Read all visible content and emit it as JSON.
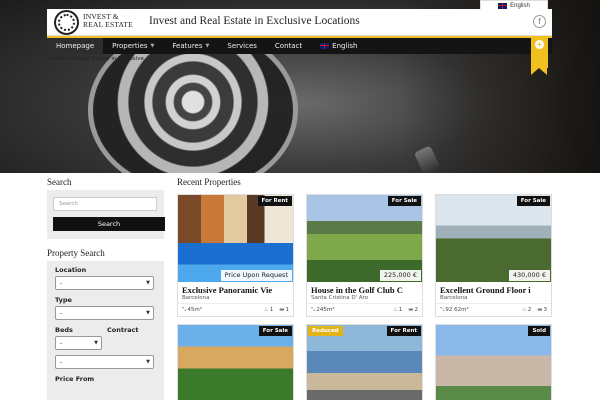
{
  "lang_top": "English",
  "header": {
    "logo_line1": "INVEST &",
    "logo_line2": "REAL ESTATE",
    "site_title": "Invest and Real Estate in Exclusive Locations"
  },
  "nav": {
    "items": [
      {
        "label": "Homepage",
        "dropdown": false
      },
      {
        "label": "Properties",
        "dropdown": true
      },
      {
        "label": "Features",
        "dropdown": true
      },
      {
        "label": "Services",
        "dropdown": false
      },
      {
        "label": "Contact",
        "dropdown": false
      },
      {
        "label": "English",
        "dropdown": false
      }
    ]
  },
  "breadcrumb": "Invest and Real Estate in Exclusive",
  "sidebar": {
    "search_title": "Search",
    "search_placeholder": "Search",
    "search_button": "Search",
    "property_search_title": "Property Search",
    "location_label": "Location",
    "location_value": "-",
    "type_label": "Type",
    "type_value": "-",
    "beds_label": "Beds",
    "beds_value": "-",
    "contract_label": "Contract",
    "contract_value": "-",
    "price_from_label": "Price From"
  },
  "main": {
    "title": "Recent Properties",
    "cards": [
      {
        "badge": "For Rent",
        "badge2": "",
        "price": "Price Upon Request",
        "title": "Exclusive Panoramic Vie",
        "location": "Barcelona",
        "area": "45m²",
        "baths": "1",
        "beds": "1"
      },
      {
        "badge": "For Sale",
        "badge2": "",
        "price": "225,000 €",
        "title": "House in the Golf Club C",
        "location": "Santa Cristina D' Aro",
        "area": "245m²",
        "baths": "1",
        "beds": "2"
      },
      {
        "badge": "For Sale",
        "badge2": "",
        "price": "430,000 €",
        "title": "Excellent Ground Floor i",
        "location": "Barcelona",
        "area": "92.62m²",
        "baths": "2",
        "beds": "3"
      },
      {
        "badge": "For Sale",
        "badge2": ""
      },
      {
        "badge": "For Rent",
        "badge2": "Reduced"
      },
      {
        "badge": "Sold",
        "badge2": ""
      }
    ]
  },
  "colors": {
    "accent": "#f0c020",
    "nav_bg": "#141414",
    "badge": "#111111",
    "reduced": "#e3b31a"
  }
}
